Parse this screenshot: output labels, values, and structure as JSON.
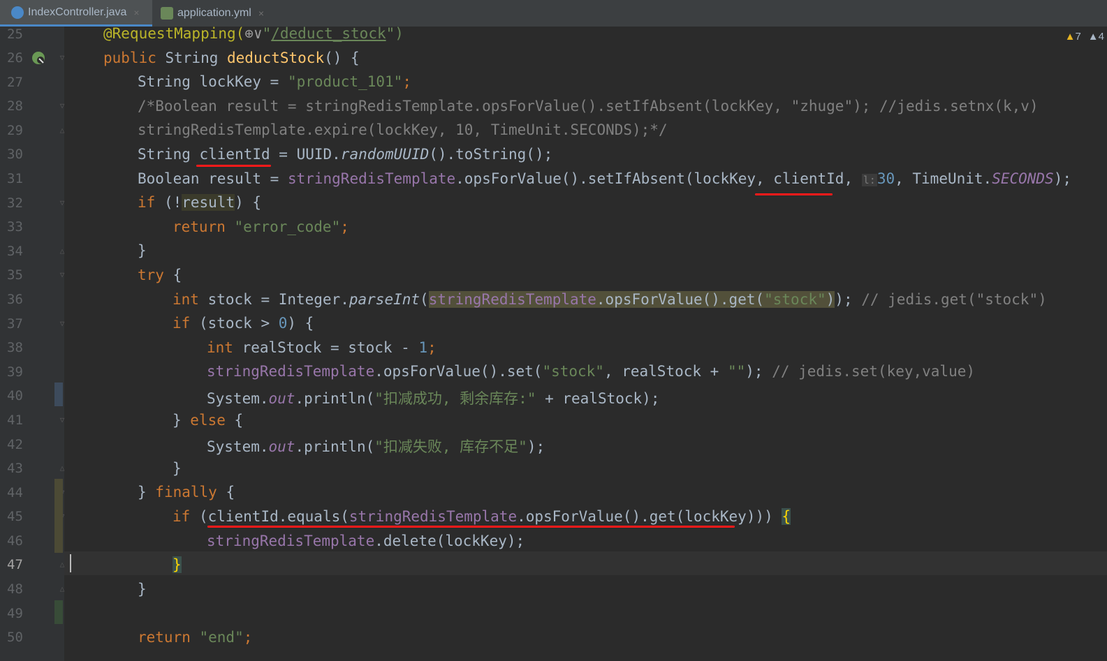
{
  "tabs": [
    {
      "label": "IndexController.java",
      "icon": "java-class-icon",
      "close": "×"
    },
    {
      "label": "application.yml",
      "icon": "yaml-config-icon",
      "close": "×"
    }
  ],
  "inspections": {
    "warnings": "7",
    "weak_warnings": "4"
  },
  "line_numbers": [
    "25",
    "26",
    "27",
    "28",
    "29",
    "30",
    "31",
    "32",
    "33",
    "34",
    "35",
    "36",
    "37",
    "38",
    "39",
    "40",
    "41",
    "42",
    "43",
    "44",
    "45",
    "46",
    "47",
    "48",
    "49",
    "50"
  ],
  "code": {
    "l25": {
      "ann": "@RequestMapping(",
      "icon": "⊕∨",
      "q1": "\"",
      "path": "/deduct_stock",
      "q2": "\")"
    },
    "l26": {
      "kw": "public",
      "type": " String ",
      "meth": "deductStock",
      "rest": "() {"
    },
    "l27": {
      "pre": "String lockKey = ",
      "str": "\"product_101\"",
      "semi": ";"
    },
    "l28": {
      "cmt": "/*Boolean result = stringRedisTemplate.opsForValue().setIfAbsent(lockKey, \"zhuge\"); //jedis.setnx(k,v)"
    },
    "l29": {
      "cmt": "stringRedisTemplate.expire(lockKey, 10, TimeUnit.SECONDS);*/"
    },
    "l30": {
      "pre": "String clientId = UUID.",
      "it": "randomUUID",
      "rest": "().toString();"
    },
    "l31": {
      "pre": "Boolean result = ",
      "fld": "stringRedisTemplate",
      "mid": ".opsForValue().setIfAbsent(lockKey, clientId, ",
      "hint": "l:",
      "num": "30",
      "mid2": ", TimeUnit.",
      "fld2": "SECONDS",
      "end": ");"
    },
    "l32": {
      "kw": "if",
      "pre": " (!",
      "var": "result",
      "rest": ") {"
    },
    "l33": {
      "kw": "return",
      "str": " \"error_code\"",
      "semi": ";"
    },
    "l34": {
      "text": "}"
    },
    "l35": {
      "kw": "try",
      "rest": " {"
    },
    "l36": {
      "kw": "int",
      "pre": " stock = Integer.",
      "it": "parseInt",
      "paren": "(",
      "fld": "stringRedisTemplate",
      "mid": ".opsForValue().get(",
      "str": "\"stock\"",
      "close": ")",
      "end": "); ",
      "cmt": "// jedis.get(\"stock\")"
    },
    "l37": {
      "kw": "if",
      "pre": " (stock > ",
      "num": "0",
      "rest": ") {"
    },
    "l38": {
      "kw": "int",
      "pre": " realStock = stock - ",
      "num": "1",
      "semi": ";"
    },
    "l39": {
      "fld": "stringRedisTemplate",
      "mid": ".opsForValue().set(",
      "str1": "\"stock\"",
      "mid2": ", realStock + ",
      "str2": "\"\"",
      "end": "); ",
      "cmt": "// jedis.set(key,value)"
    },
    "l40": {
      "pre": "System.",
      "fld": "out",
      "mid": ".println(",
      "str": "\"扣减成功, 剩余库存:\"",
      "end": " + realStock);"
    },
    "l41": {
      "pre": "} ",
      "kw": "else",
      "rest": " {"
    },
    "l42": {
      "pre": "System.",
      "fld": "out",
      "mid": ".println(",
      "str": "\"扣减失败, 库存不足\"",
      "end": ");"
    },
    "l43": {
      "text": "}"
    },
    "l44": {
      "pre": "} ",
      "kw": "finally",
      "rest": " {"
    },
    "l45": {
      "kw": "if",
      "pre": " (clientId.equals(",
      "fld": "stringRedisTemplate",
      "mid": ".opsForValue().get(lockKey))) ",
      "brace": "{"
    },
    "l46": {
      "fld": "stringRedisTemplate",
      "mid": ".delete(lockKey);"
    },
    "l47": {
      "brace": "}"
    },
    "l48": {
      "text": "}"
    },
    "l49": {
      "text": ""
    },
    "l50": {
      "kw": "return",
      "str": " \"end\"",
      "semi": ";"
    }
  },
  "colors": {
    "keyword": "#cc7832",
    "string": "#6a8759",
    "number": "#6897bb",
    "annotation": "#bbb529",
    "field": "#9876aa",
    "comment": "#808080",
    "underline": "#ff1a1a"
  }
}
